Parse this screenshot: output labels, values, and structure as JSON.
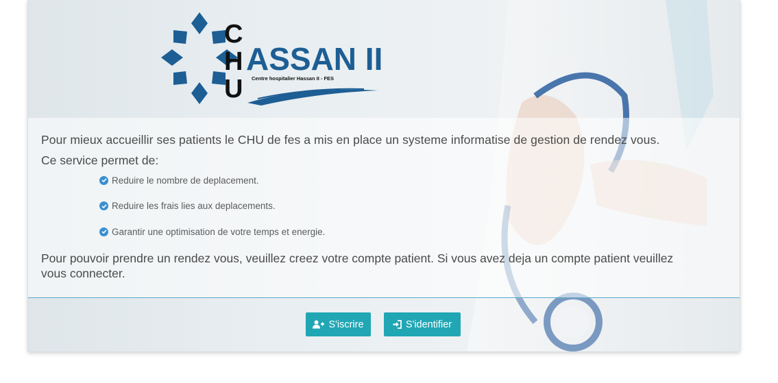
{
  "logo": {
    "letters_vertical": [
      "C",
      "H",
      "U"
    ],
    "name": "ASSAN II",
    "subtitle": "Centre hospitalier Hassan II - FES"
  },
  "intro": {
    "text": "Pour mieux accueillir ses patients le CHU de fes a mis en place un systeme informatise de gestion de rendez vous.",
    "subhead": "Ce service permet de:"
  },
  "features": [
    {
      "icon": "check-circle-icon",
      "label": "Reduire le nombre de deplacement."
    },
    {
      "icon": "check-circle-icon",
      "label": "Reduire les frais lies aux deplacements."
    },
    {
      "icon": "check-circle-icon",
      "label": "Garantir une optimisation de votre temps et energie."
    }
  ],
  "closing": {
    "text": "Pour pouvoir prendre un rendez vous, veuillez creez votre compte patient. Si vous avez deja un compte patient veuillez vous connecter."
  },
  "actions": {
    "register_label": "S'iscrire",
    "register_icon": "user-plus-icon",
    "login_label": "S'identifier",
    "login_icon": "sign-in-icon"
  },
  "colors": {
    "button": "#21a6b4",
    "check": "#3a8fd0",
    "logo_blue": "#1d5e94",
    "text": "#4a4a4a"
  }
}
